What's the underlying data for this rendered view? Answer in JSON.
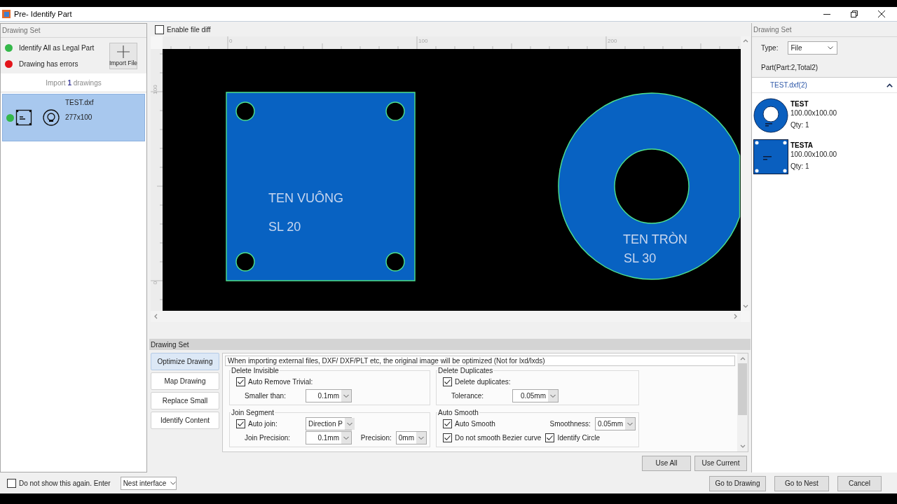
{
  "window": {
    "title": "Pre- Identify Part"
  },
  "left_panel": {
    "header": "Drawing Set",
    "legend": [
      {
        "label": "Identify All as Legal Part",
        "color": "#34b84a"
      },
      {
        "label": "Drawing has errors",
        "color": "#e3151b"
      }
    ],
    "import_button": "Import File",
    "import_summary": "Import **1** drawings",
    "files": [
      {
        "name": "TEST.dxf",
        "size": "277x100",
        "color": "#34b84a",
        "selected": true
      }
    ]
  },
  "file_diff": {
    "label": "Enable file diff",
    "checked": false
  },
  "canvas": {
    "ruler_top_labels": [
      "0",
      "100",
      "200"
    ],
    "ruler_left_labels": [
      "100",
      "0"
    ],
    "parts": [
      {
        "kind": "plate",
        "labels": [
          "TEN VUÔNG",
          "SL 20"
        ]
      },
      {
        "kind": "ring",
        "labels": [
          "TEN TRÒN",
          "SL 30"
        ]
      }
    ]
  },
  "options": {
    "header": "Drawing Set",
    "tabs": [
      {
        "label": "Optimize Drawing",
        "selected": true
      },
      {
        "label": "Map Drawing",
        "selected": false
      },
      {
        "label": "Replace Small",
        "selected": false
      },
      {
        "label": "Identify Content",
        "selected": false
      }
    ],
    "description": "When importing external files, DXF/ DXF/PLT etc, the original image will be optimized (Not for lxd/lxds)",
    "groups": [
      {
        "title": "Delete Invisible",
        "rows": [
          [
            {
              "kind": "checkbox",
              "label": "Auto Remove Trivial:",
              "checked": true
            }
          ],
          [
            {
              "kind": "label",
              "text": "Smaller than:"
            },
            {
              "kind": "select",
              "value": "0.1mm"
            }
          ]
        ]
      },
      {
        "title": "Delete Duplicates",
        "rows": [
          [
            {
              "kind": "checkbox",
              "label": "Delete duplicates:",
              "checked": true
            }
          ],
          [
            {
              "kind": "label",
              "text": "Tolerance:"
            },
            {
              "kind": "select",
              "value": "0.05mm"
            }
          ]
        ]
      },
      {
        "title": "Join Segment",
        "rows": [
          [
            {
              "kind": "checkbox",
              "label": "Auto join:",
              "checked": true
            },
            {
              "kind": "select",
              "value": "Direction P"
            }
          ],
          [
            {
              "kind": "label",
              "text": "Join Precision:"
            },
            {
              "kind": "select",
              "value": "0.1mm"
            },
            {
              "kind": "label",
              "text": "Precision:"
            },
            {
              "kind": "select",
              "value": "0mm"
            }
          ]
        ]
      },
      {
        "title": "Auto Smooth",
        "rows": [
          [
            {
              "kind": "checkbox",
              "label": "Auto Smooth",
              "checked": true
            },
            {
              "kind": "label",
              "text": "Smoothness:"
            },
            {
              "kind": "select",
              "value": "0.05mm"
            }
          ],
          [
            {
              "kind": "checkbox",
              "label": "Do not smooth Bezier curve",
              "checked": true
            },
            {
              "kind": "checkbox",
              "label": "Identify Circle",
              "checked": true
            }
          ]
        ]
      }
    ],
    "buttons": [
      "Use All",
      "Use Current"
    ]
  },
  "right_panel": {
    "header": "Drawing Set",
    "type_label": "Type:",
    "type_value": "File",
    "summary": "Part(Part:2,Total2)",
    "group": {
      "title": "TEST.dxf(2)",
      "expanded": true,
      "parts": [
        {
          "kind": "ring",
          "name": "TEST",
          "size": "100.00x100.00",
          "qty": "Qty: 1"
        },
        {
          "kind": "plate",
          "name": "TESTA",
          "size": "100.00x100.00",
          "qty": "Qty: 1"
        }
      ]
    }
  },
  "footer": {
    "dont_show": {
      "label": "Do not show this again. Enter",
      "checked": false
    },
    "nest_select": "Nest interface",
    "buttons": [
      "Go to Drawing",
      "Go to Nest",
      "Cancel"
    ]
  }
}
